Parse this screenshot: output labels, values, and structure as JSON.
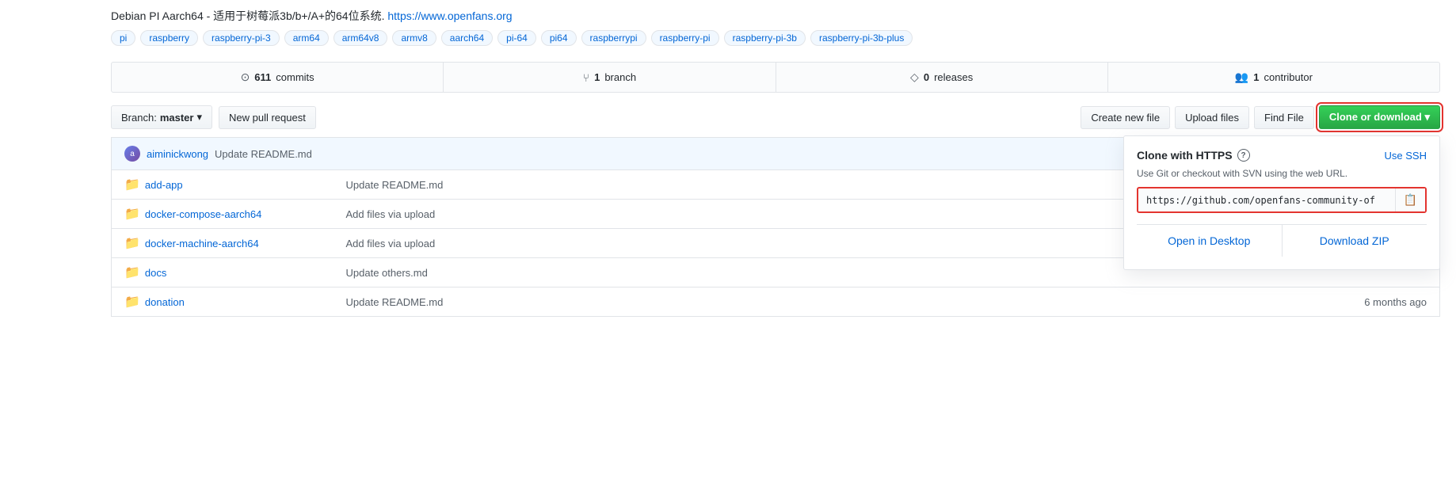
{
  "description": {
    "text": "Debian PI Aarch64 - 适用于树莓派3b/b+/A+的64位系统.",
    "link_text": "https://www.openfans.org",
    "link_url": "https://www.openfans.org"
  },
  "tags": [
    "pi",
    "raspberry",
    "raspberry-pi-3",
    "arm64",
    "arm64v8",
    "armv8",
    "aarch64",
    "pi-64",
    "pi64",
    "raspberrypi",
    "raspberry-pi",
    "raspberry-pi-3b",
    "raspberry-pi-3b-plus"
  ],
  "stats": [
    {
      "icon": "⊙",
      "count": "611",
      "label": "commits"
    },
    {
      "icon": "⑂",
      "count": "1",
      "label": "branch"
    },
    {
      "icon": "◇",
      "count": "0",
      "label": "releases"
    },
    {
      "icon": "👥",
      "count": "1",
      "label": "contributor"
    }
  ],
  "toolbar": {
    "branch_label": "Branch:",
    "branch_name": "master",
    "new_pull_request": "New pull request",
    "create_new_file": "Create new file",
    "upload_files": "Upload files",
    "find_file": "Find File",
    "clone_or_download": "Clone or download ▾"
  },
  "commit_info": {
    "author": "aiminickwong",
    "message": "Update README.md"
  },
  "files": [
    {
      "name": "add-app",
      "type": "folder",
      "commit": "Update README.md",
      "time": ""
    },
    {
      "name": "docker-compose-aarch64",
      "type": "folder",
      "commit": "Add files via upload",
      "time": ""
    },
    {
      "name": "docker-machine-aarch64",
      "type": "folder",
      "commit": "Add files via upload",
      "time": ""
    },
    {
      "name": "docs",
      "type": "folder",
      "commit": "Update others.md",
      "time": ""
    },
    {
      "name": "donation",
      "type": "folder",
      "commit": "Update README.md",
      "time": "6 months ago"
    }
  ],
  "clone_panel": {
    "title": "Clone with HTTPS",
    "help_icon": "?",
    "use_ssh": "Use SSH",
    "description": "Use Git or checkout with SVN using the web URL.",
    "url": "https://github.com/openfans-community-of",
    "open_desktop": "Open in Desktop",
    "download_zip": "Download ZIP"
  }
}
